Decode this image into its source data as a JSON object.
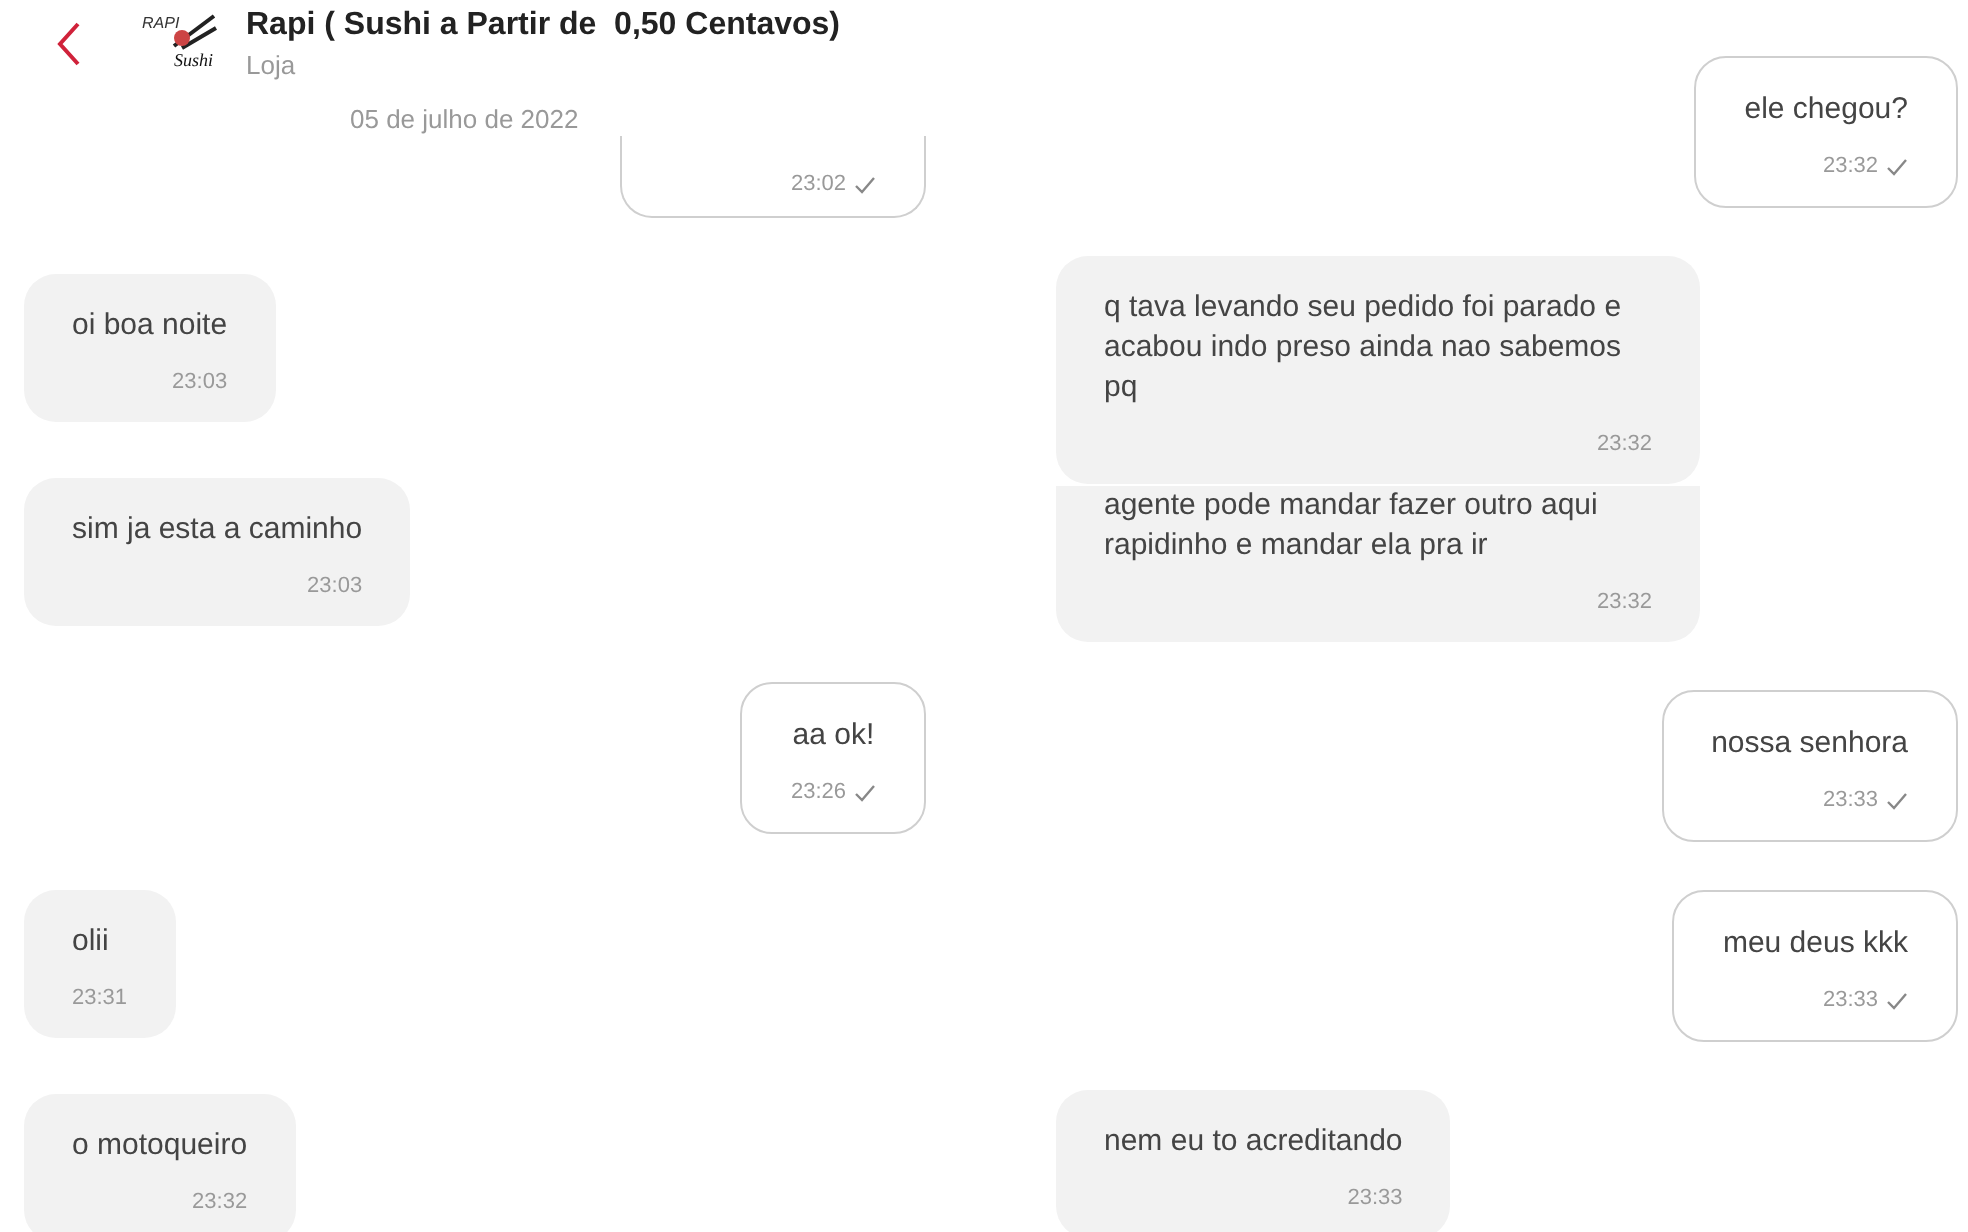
{
  "panels": [
    {
      "header": {
        "title": "Rapi ( Sushi a Partir de  0,50 Centavos)",
        "subtitle": "Loja",
        "logo_text": [
          "RAPI",
          "Sushi"
        ]
      },
      "date": "05 de julho de 2022",
      "messages": [
        {
          "kind": "sent",
          "time": "23:02",
          "clipped_top": true
        },
        {
          "kind": "received",
          "text": "oi boa noite",
          "time": "23:03",
          "clipped_top": false
        },
        {
          "kind": "received",
          "text": "sim ja esta a caminho",
          "time": "23:03",
          "clipped_top": false
        },
        {
          "kind": "sent",
          "text": "aa ok!",
          "time": "23:26",
          "clipped_top": false
        },
        {
          "kind": "received",
          "text": "olii",
          "time": "23:31",
          "clipped_top": false
        },
        {
          "kind": "received",
          "text": "o motoqueiro",
          "time": "23:32",
          "clipped_top": false
        }
      ]
    },
    {
      "messages": [
        {
          "kind": "sent",
          "text": "ele chegou?",
          "time": "23:32",
          "clipped_top": false
        },
        {
          "kind": "received",
          "text": "q tava levando seu pedido foi parado e acabou indo preso ainda nao sabemos pq",
          "time": "23:32",
          "clipped_top": false
        },
        {
          "kind": "received",
          "text": "agente pode mandar fazer outro aqui rapidinho e mandar ela pra ir",
          "time": "23:32",
          "clipped_top": true
        },
        {
          "kind": "sent",
          "text": "nossa senhora",
          "time": "23:33",
          "clipped_top": false
        },
        {
          "kind": "sent",
          "text": "meu deus kkk",
          "time": "23:33",
          "clipped_top": false
        },
        {
          "kind": "received",
          "text": "nem eu to acreditando",
          "time": "23:33",
          "clipped_top": false
        }
      ]
    }
  ]
}
